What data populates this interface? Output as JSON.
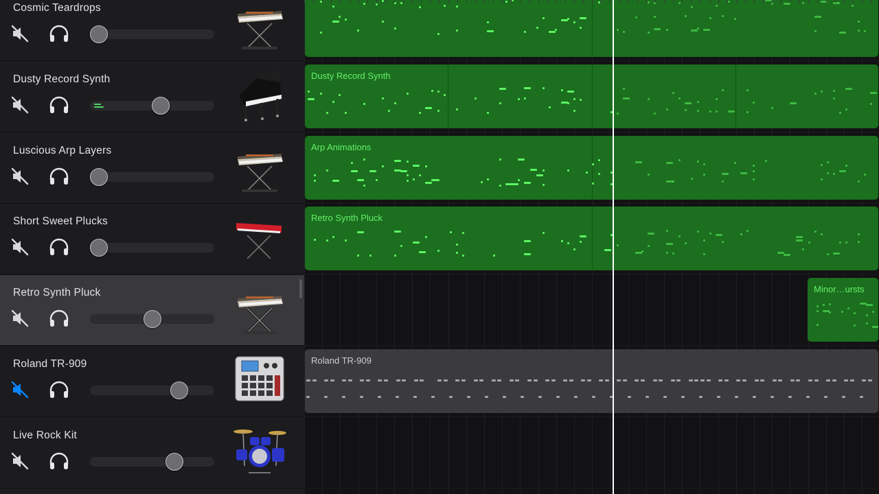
{
  "tracks": [
    {
      "name": "Cosmic Teardrops",
      "muted": false,
      "volume": 0.07,
      "meter": 0,
      "instrument": "keyboard-stand-icon",
      "selected": false
    },
    {
      "name": "Dusty Record Synth",
      "muted": false,
      "volume": 0.57,
      "meter": 2,
      "instrument": "grand-piano-icon",
      "selected": false
    },
    {
      "name": "Luscious Arp Layers",
      "muted": false,
      "volume": 0.07,
      "meter": 0,
      "instrument": "keyboard-stand-icon",
      "selected": false
    },
    {
      "name": "Short Sweet Plucks",
      "muted": false,
      "volume": 0.07,
      "meter": 0,
      "instrument": "red-synth-icon",
      "selected": false
    },
    {
      "name": "Retro Synth Pluck",
      "muted": false,
      "volume": 0.5,
      "meter": 0,
      "instrument": "keyboard-stand-icon",
      "selected": true
    },
    {
      "name": "Roland TR-909",
      "muted": true,
      "volume": 0.72,
      "meter": 0,
      "instrument": "drum-machine-icon",
      "selected": false
    },
    {
      "name": "Live Rock Kit",
      "muted": false,
      "volume": 0.68,
      "meter": 0,
      "instrument": "drum-kit-icon",
      "selected": false
    }
  ],
  "regions": [
    {
      "lane": 0,
      "label": "",
      "kind": "midi",
      "start": 0.0,
      "end": 1.0,
      "splits": [
        0.5
      ]
    },
    {
      "lane": 1,
      "label": "Dusty Record Synth",
      "kind": "midi",
      "start": 0.0,
      "end": 1.0,
      "splits": [
        0.25,
        0.5,
        0.75
      ]
    },
    {
      "lane": 2,
      "label": "Arp Animations",
      "kind": "midi",
      "start": 0.0,
      "end": 1.0,
      "splits": [
        0.5
      ]
    },
    {
      "lane": 3,
      "label": "Retro Synth Pluck",
      "kind": "midi",
      "start": 0.0,
      "end": 1.0,
      "splits": [
        0.5
      ]
    },
    {
      "lane": 4,
      "label": "Minor…ursts",
      "kind": "midi",
      "start": 0.874,
      "end": 1.0,
      "splits": []
    },
    {
      "lane": 5,
      "label": "Roland TR-909",
      "kind": "drum",
      "start": 0.0,
      "end": 1.0,
      "splits": []
    }
  ],
  "playhead_position": 0.537,
  "colors": {
    "midi_region": "#1b6f1e",
    "midi_note": "#5df563",
    "drum_region": "#3b3b3d",
    "mute_active": "#0a84ff",
    "selected_header": "#39393c"
  }
}
